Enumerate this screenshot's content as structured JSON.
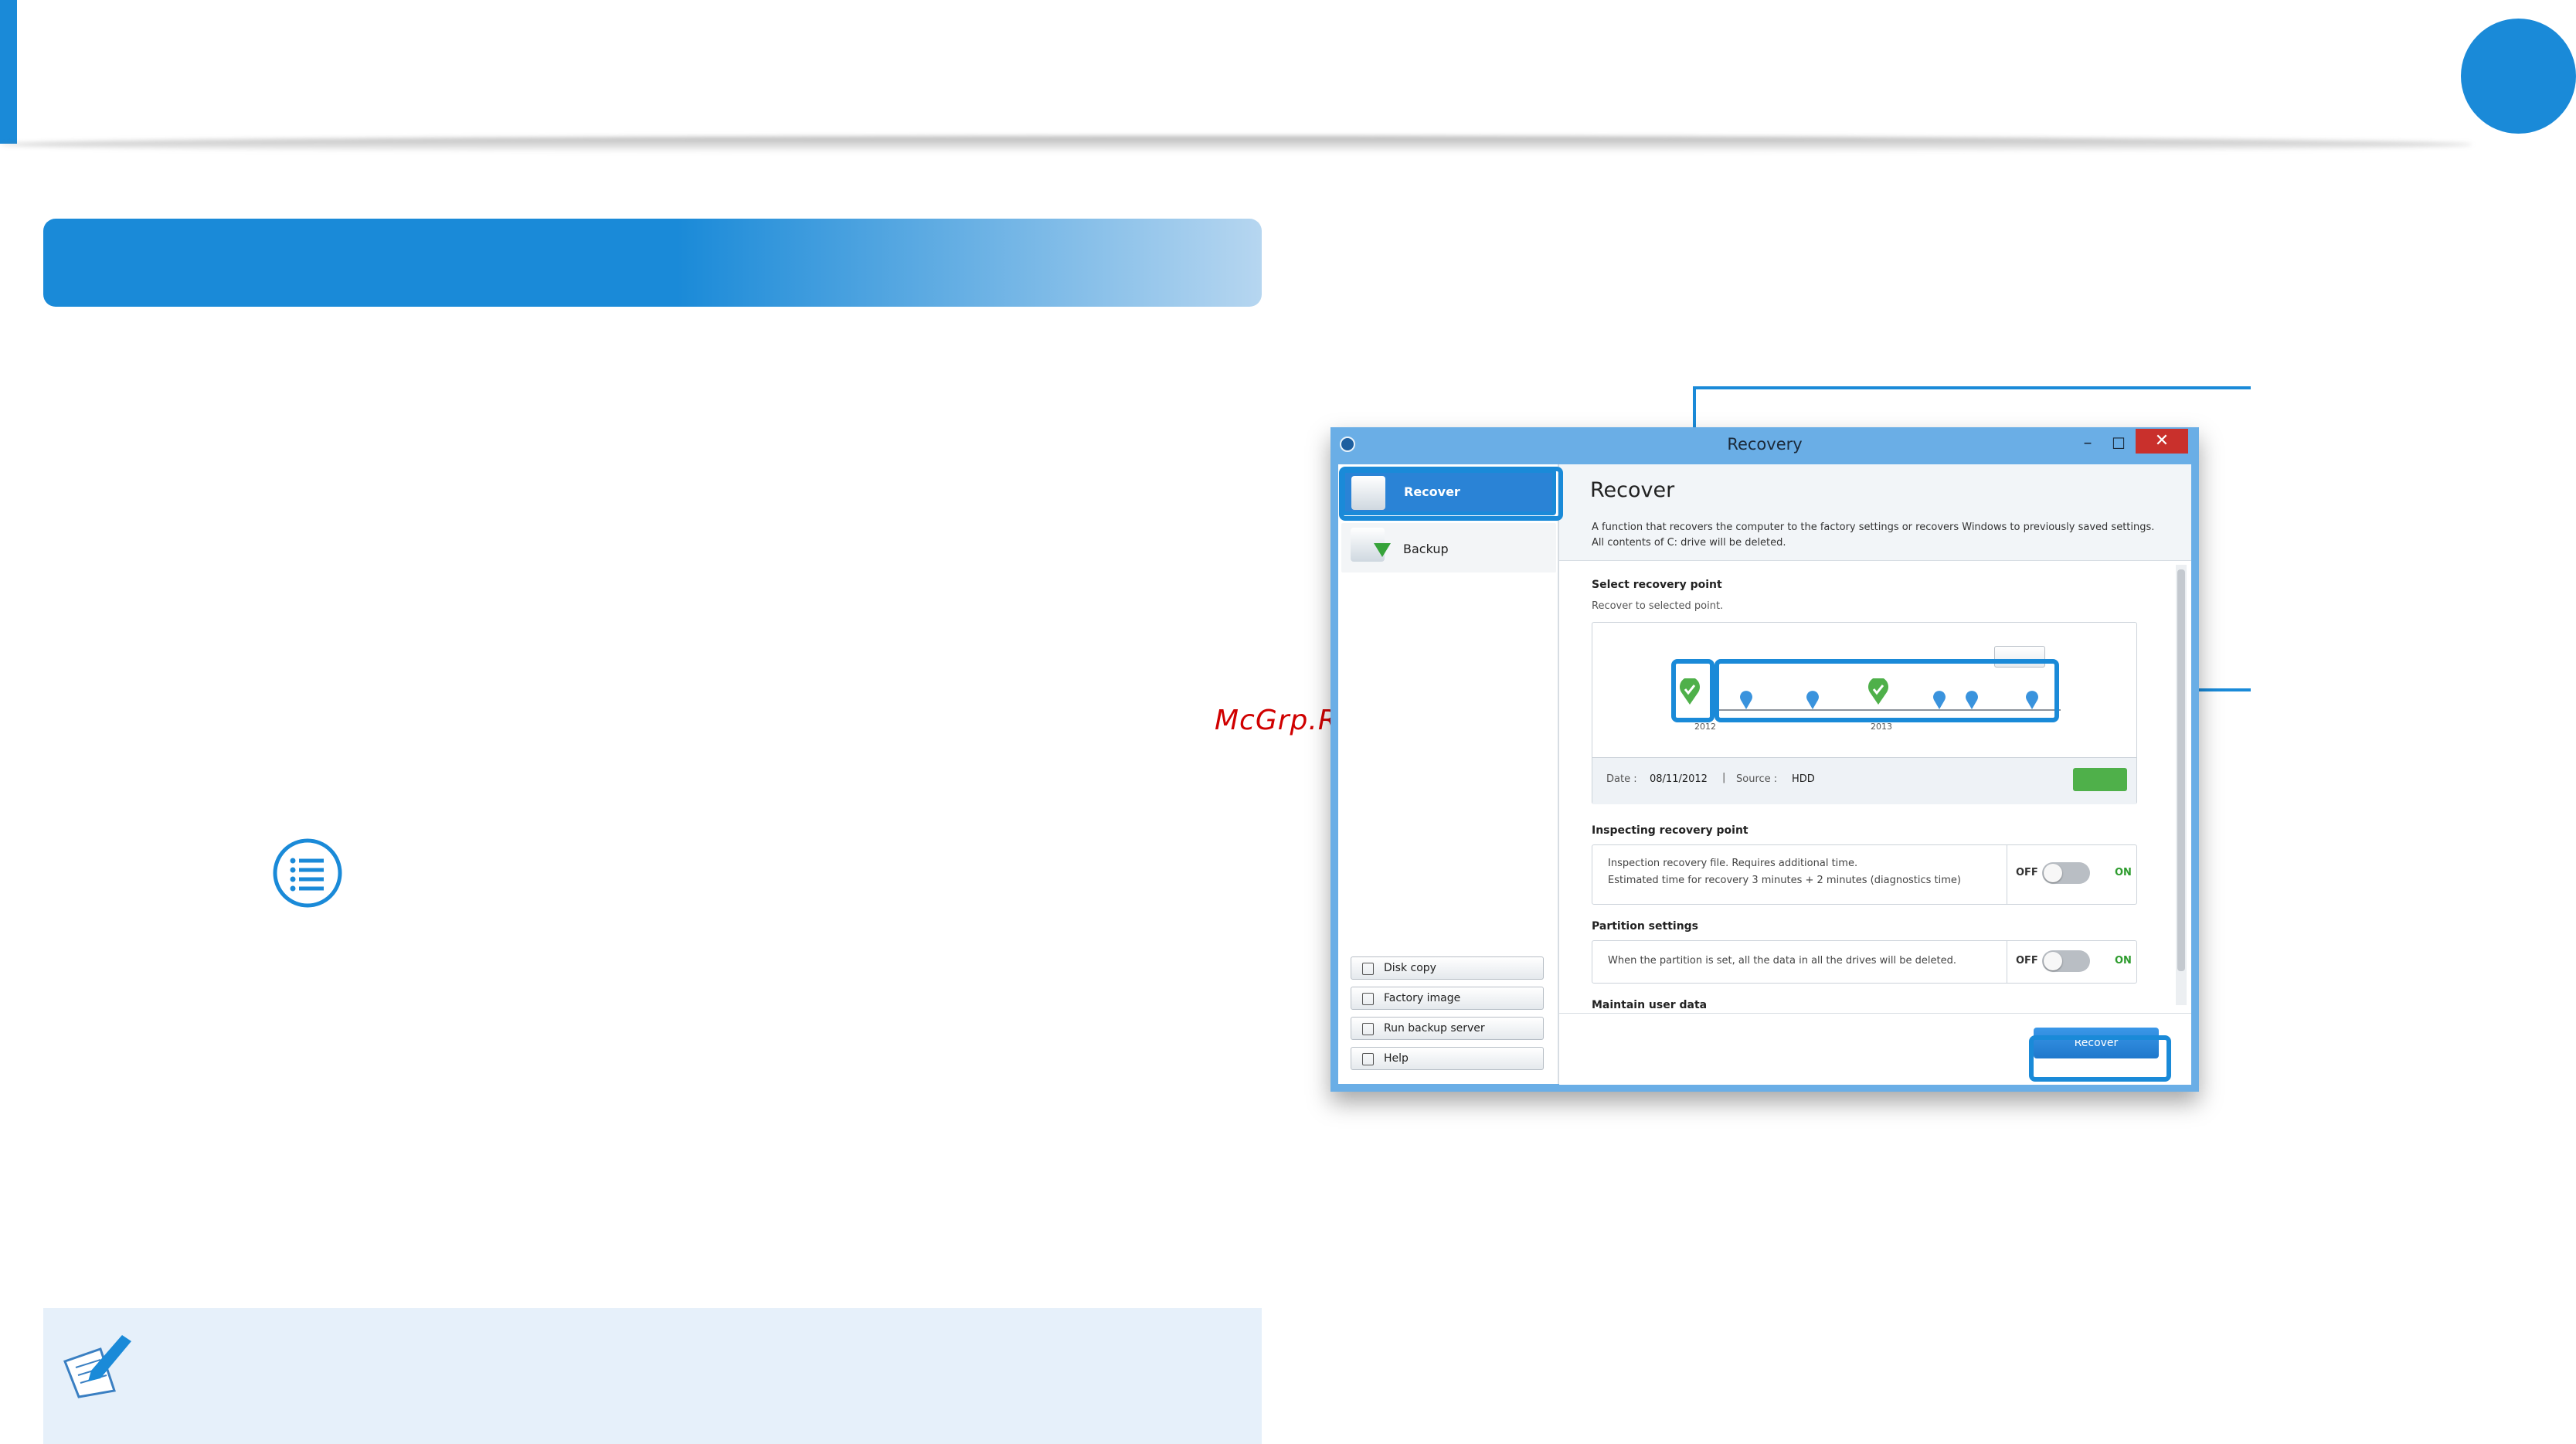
{
  "watermark": "McGrp.Ru",
  "window": {
    "title": "Recovery",
    "controls": {
      "minimize": "–",
      "maximize": "☐",
      "close": "✕"
    }
  },
  "sidebar": {
    "items": [
      {
        "label": "Recover",
        "icon": "recover-icon",
        "selected": true
      },
      {
        "label": "Backup",
        "icon": "backup-icon",
        "selected": false
      }
    ],
    "buttons": [
      {
        "label": "Disk copy",
        "icon": "disk-copy-icon"
      },
      {
        "label": "Factory image",
        "icon": "factory-image-icon"
      },
      {
        "label": "Run backup server",
        "icon": "backup-server-icon"
      },
      {
        "label": "Help",
        "icon": "help-icon"
      }
    ]
  },
  "content": {
    "title": "Recover",
    "description_line1": "A function that recovers the computer to the factory settings or recovers Windows to previously saved settings.",
    "description_line2": "All contents of C: drive will be deleted.",
    "select_point": {
      "label": "Select recovery point",
      "sub": "Recover to selected point.",
      "year_labels": [
        "2012",
        "2013"
      ],
      "date_label": "Date :",
      "date_value": "08/11/2012",
      "separator": "|",
      "source_label": "Source :",
      "source_value": "HDD"
    },
    "inspecting": {
      "label": "Inspecting recovery point",
      "line1": "Inspection recovery file. Requires additional time.",
      "line2": "Estimated time for recovery 3 minutes + 2 minutes (diagnostics time)",
      "off": "OFF",
      "on": "ON"
    },
    "partition": {
      "label": "Partition settings",
      "line1": "When the partition is set, all the data in all the drives will be deleted.",
      "off": "OFF",
      "on": "ON"
    },
    "maintain": {
      "label": "Maintain user data"
    },
    "recover_button": "Recover"
  },
  "colors": {
    "accent": "#1a8ad8",
    "close": "#c9302c",
    "on": "#2e9c2e"
  }
}
